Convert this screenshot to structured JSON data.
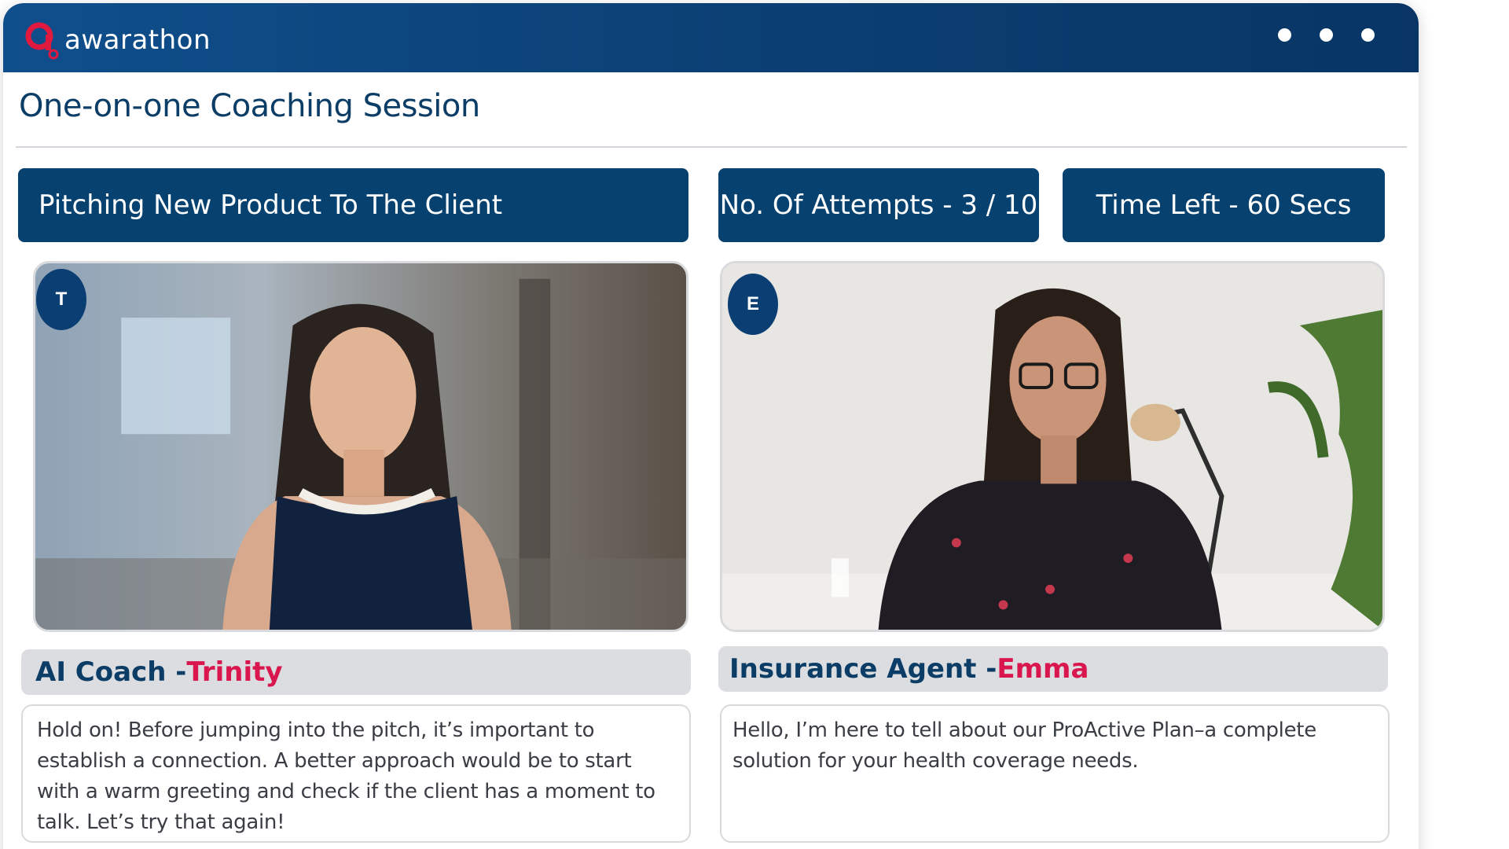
{
  "header": {
    "brand": "awarathon",
    "colors": {
      "bar": "#0b3f73",
      "accent": "#d9164d"
    },
    "menu_icon": "more-horizontal-icon"
  },
  "page": {
    "title": "One-on-one Coaching Session"
  },
  "session": {
    "topic": "Pitching New Product To The Client",
    "attempts": "No. Of Attempts - 3 / 10",
    "time_left": "Time Left - 60 Secs"
  },
  "participants": {
    "coach": {
      "badge": "T",
      "role": "AI Coach - ",
      "name": "Trinity",
      "message": "Hold on! Before jumping into the pitch, it’s important to establish a connection. A better approach would be to start with a warm greeting and check if the client has a moment to talk. Let’s try that again!"
    },
    "agent": {
      "badge": "E",
      "role": "Insurance Agent - ",
      "name": "Emma",
      "message": "Hello, I’m here to tell about our ProActive Plan–a complete solution for your health coverage needs."
    }
  }
}
